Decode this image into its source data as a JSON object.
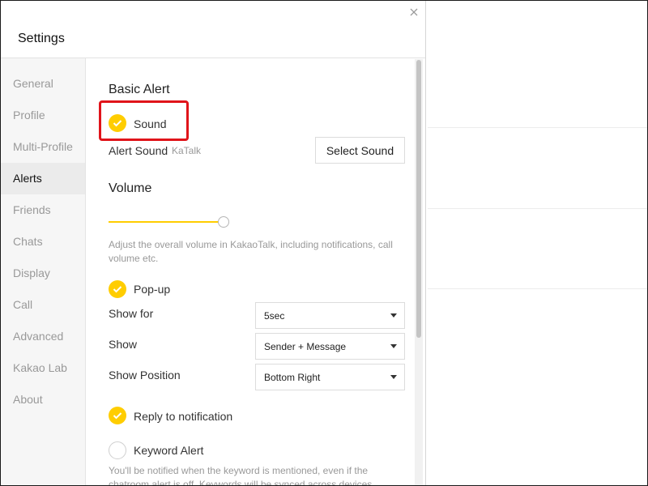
{
  "window": {
    "title": "Settings",
    "close_icon": "close-icon"
  },
  "sidebar": {
    "items": [
      {
        "label": "General",
        "active": false
      },
      {
        "label": "Profile",
        "active": false
      },
      {
        "label": "Multi-Profile",
        "active": false
      },
      {
        "label": "Alerts",
        "active": true
      },
      {
        "label": "Friends",
        "active": false
      },
      {
        "label": "Chats",
        "active": false
      },
      {
        "label": "Display",
        "active": false
      },
      {
        "label": "Call",
        "active": false
      },
      {
        "label": "Advanced",
        "active": false
      },
      {
        "label": "Kakao Lab",
        "active": false
      },
      {
        "label": "About",
        "active": false
      }
    ]
  },
  "alerts": {
    "basic_heading": "Basic Alert",
    "sound": {
      "label": "Sound",
      "checked": true
    },
    "alert_sound": {
      "label": "Alert Sound",
      "value": "KaTalk",
      "button": "Select Sound"
    },
    "volume": {
      "heading": "Volume",
      "level": 1.0,
      "description": "Adjust the overall volume in KakaoTalk, including notifications, call volume etc."
    },
    "popup": {
      "label": "Pop-up",
      "checked": true
    },
    "show_for": {
      "label": "Show for",
      "value": "5sec"
    },
    "show": {
      "label": "Show",
      "value": "Sender + Message"
    },
    "show_position": {
      "label": "Show Position",
      "value": "Bottom Right"
    },
    "reply": {
      "label": "Reply to notification",
      "checked": true
    },
    "keyword": {
      "label": "Keyword Alert",
      "checked": false,
      "description": "You'll be notified when the keyword is mentioned, even if the chatroom alert is off. Keywords will be synced across devices."
    }
  },
  "colors": {
    "accent": "#ffcd00",
    "highlight": "#e0141a"
  }
}
